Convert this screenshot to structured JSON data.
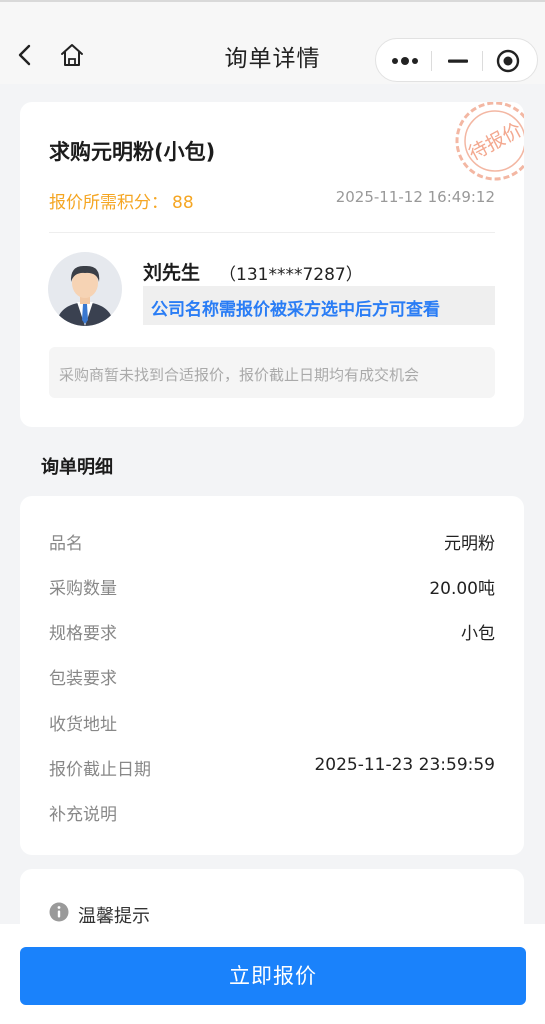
{
  "header": {
    "title": "询单详情",
    "back_icon": "back-arrow-icon",
    "home_icon": "home-icon",
    "capsule": {
      "more_icon": "more-dots-icon",
      "minimize_icon": "minimize-icon",
      "close_icon": "close-target-icon"
    }
  },
  "inquiry": {
    "title": "求购元明粉(小包)",
    "points_label": "报价所需积分：",
    "points_value": "88",
    "datetime": "2025-11-12 16:49:12",
    "status_stamp": "待报价",
    "buyer": {
      "name": "刘先生",
      "phone": "（131****7287）",
      "company_notice": "公司名称需报价被采方选中后方可查看"
    },
    "hint": "采购商暂未找到合适报价，报价截止日期均有成交机会"
  },
  "details": {
    "section_title": "询单明细",
    "rows": [
      {
        "label": "品名",
        "value": "元明粉"
      },
      {
        "label": "采购数量",
        "value": "20.00吨"
      },
      {
        "label": "规格要求",
        "value": "小包"
      },
      {
        "label": "包装要求",
        "value": ""
      },
      {
        "label": "收货地址",
        "value": ""
      },
      {
        "label": "报价截止日期",
        "value": "2025-11-23 23:59:59"
      },
      {
        "label": "补充说明",
        "value": ""
      }
    ]
  },
  "tips": {
    "title": "温馨提示",
    "icon": "info-icon"
  },
  "action": {
    "quote_label": "立即报价"
  },
  "colors": {
    "accent_blue": "#1a82fb",
    "points_orange": "#f5a623",
    "notice_blue": "#2a7df5",
    "stamp_orange": "#f3a88f"
  }
}
